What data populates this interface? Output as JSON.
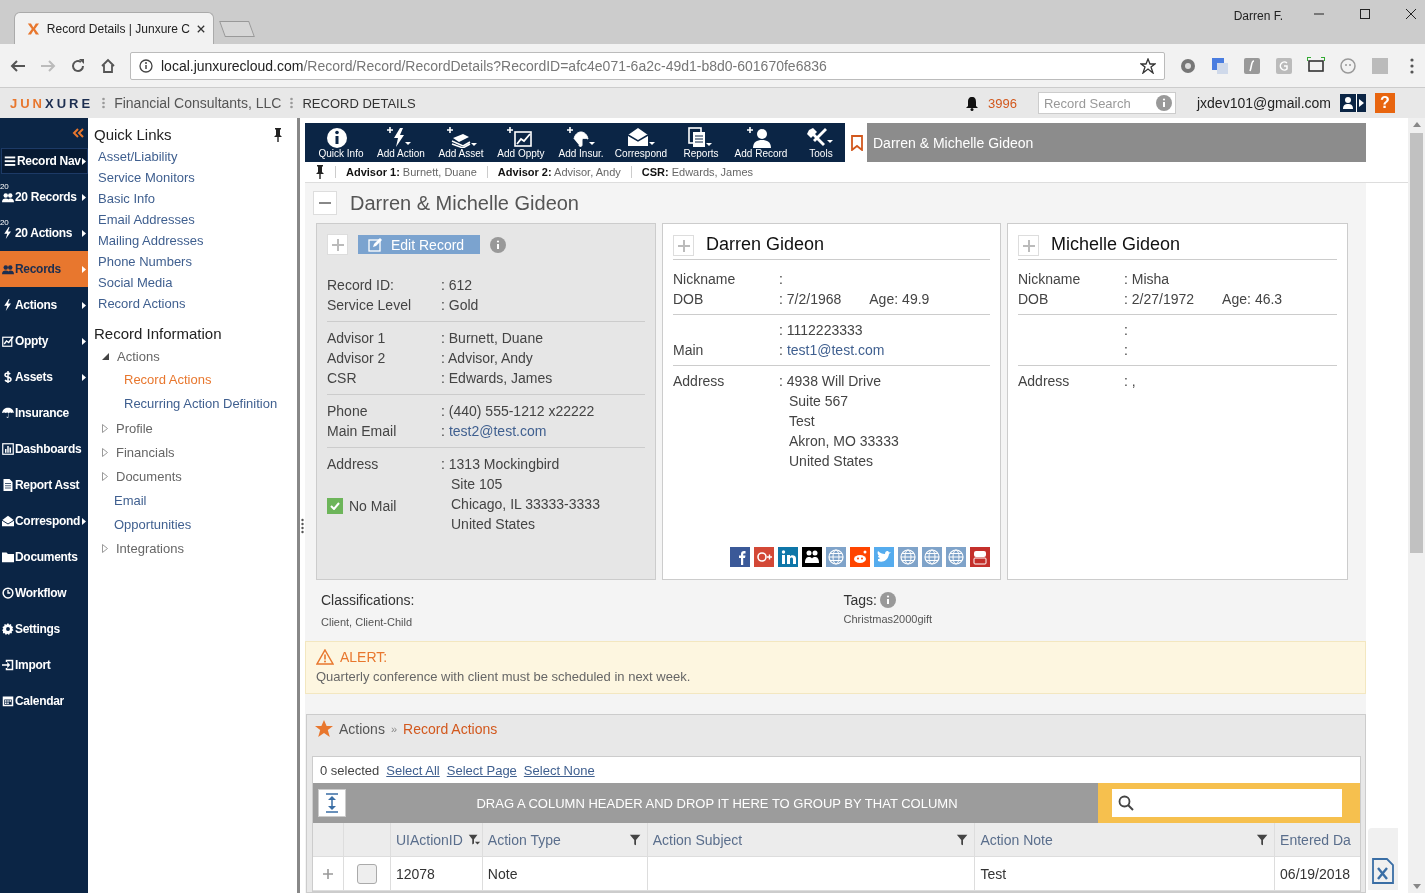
{
  "browser": {
    "tab_title": "Record Details | Junxure C",
    "url_host": "local.junxurecloud.com",
    "url_path": "/Record/Record/RecordDetails?RecordID=afc4e071-6a2c-49d1-b8d0-601670fe6836",
    "profile": "Darren F."
  },
  "app_header": {
    "logo": [
      "JUN",
      "XURE"
    ],
    "company": "Financial Consultants, LLC",
    "page": "RECORD DETAILS",
    "notification_count": "3996",
    "search": {
      "placeholder": "Record Search"
    },
    "email": "jxdev101@gmail.com",
    "help": "?"
  },
  "nav": [
    {
      "label": "Record Nav",
      "kind": "header",
      "submenu": true,
      "selected": false
    },
    {
      "label": "20 Records",
      "kind": "item",
      "badge": "20",
      "submenu": true,
      "selected": false
    },
    {
      "label": "20 Actions",
      "kind": "item",
      "badge": "20",
      "submenu": true,
      "selected": false
    },
    {
      "label": "Records",
      "kind": "item",
      "submenu": true,
      "selected": true
    },
    {
      "label": "Actions",
      "kind": "item",
      "submenu": true,
      "selected": false
    },
    {
      "label": "Oppty",
      "kind": "item",
      "submenu": true,
      "selected": false
    },
    {
      "label": "Assets",
      "kind": "item",
      "submenu": true,
      "selected": false
    },
    {
      "label": "Insurance",
      "kind": "item",
      "submenu": false,
      "selected": false
    },
    {
      "label": "Dashboards",
      "kind": "item",
      "submenu": false,
      "selected": false
    },
    {
      "label": "Report Asst",
      "kind": "item",
      "submenu": false,
      "selected": false
    },
    {
      "label": "Correspond",
      "kind": "item",
      "submenu": true,
      "selected": false
    },
    {
      "label": "Documents",
      "kind": "item",
      "submenu": false,
      "selected": false
    },
    {
      "label": "Workflow",
      "kind": "item",
      "submenu": false,
      "selected": false
    },
    {
      "label": "Settings",
      "kind": "item",
      "submenu": false,
      "selected": false
    },
    {
      "label": "Import",
      "kind": "item",
      "submenu": false,
      "selected": false
    },
    {
      "label": "Calendar",
      "kind": "item",
      "submenu": false,
      "selected": false
    }
  ],
  "quick_links": {
    "title": "Quick Links",
    "links": [
      "Asset/Liability",
      "Service Monitors",
      "Basic Info",
      "Email Addresses",
      "Mailing Addresses",
      "Phone Numbers",
      "Social Media",
      "Record Actions"
    ]
  },
  "record_information": {
    "title": "Record Information",
    "tree": [
      {
        "label": "Actions",
        "kind": "group",
        "expanded": true,
        "children": [
          {
            "label": "Record Actions",
            "selected": true
          },
          {
            "label": "Recurring Action Definition",
            "selected": false
          }
        ]
      },
      {
        "label": "Profile",
        "kind": "group",
        "expanded": false
      },
      {
        "label": "Financials",
        "kind": "group",
        "expanded": false
      },
      {
        "label": "Documents",
        "kind": "group",
        "expanded": false
      },
      {
        "label": "Email",
        "kind": "leaf"
      },
      {
        "label": "Opportunities",
        "kind": "leaf"
      },
      {
        "label": "Integrations",
        "kind": "group",
        "expanded": false
      }
    ]
  },
  "toolbar": {
    "buttons": [
      "Quick Info",
      "Add Action",
      "Add Asset",
      "Add Oppty",
      "Add Insur.",
      "Correspond",
      "Reports",
      "Add Record",
      "Tools"
    ],
    "record_title": "Darren & Michelle Gideon"
  },
  "advisor_bar": [
    {
      "label": "Advisor 1:",
      "value": "Burnett, Duane"
    },
    {
      "label": "Advisor 2:",
      "value": "Advisor, Andy"
    },
    {
      "label": "CSR:",
      "value": "Edwards, James"
    }
  ],
  "record": {
    "title": "Darren & Michelle Gideon",
    "main_card": {
      "edit_button": "Edit Record",
      "sections": [
        [
          {
            "label": "Record ID:",
            "value": ": 612"
          },
          {
            "label": "Service Level",
            "value": ": Gold"
          }
        ],
        [
          {
            "label": "Advisor 1",
            "value": ": Burnett, Duane"
          },
          {
            "label": "Advisor 2",
            "value": ": Advisor, Andy"
          },
          {
            "label": "CSR",
            "value": ": Edwards, James"
          }
        ],
        [
          {
            "label": "Phone",
            "value": ": (440) 555-1212 x22222"
          },
          {
            "label": "Main Email",
            "value": ":",
            "link": "test2@test.com"
          }
        ],
        [
          {
            "label": "Address",
            "value": ": 1313 Mockingbird",
            "lines": [
              "Site 105",
              "Chicago, IL 33333-3333",
              "United States"
            ]
          }
        ]
      ],
      "no_mail": {
        "label": "No Mail",
        "checked": true
      }
    },
    "people": [
      {
        "name": "Darren Gideon",
        "sections": [
          [
            {
              "label": "Nickname",
              "value": ":"
            },
            {
              "label": "DOB",
              "value": ": 7/2/1968",
              "age_label": "Age:",
              "age": "49.9"
            }
          ],
          [
            {
              "value": ": 1112223333"
            },
            {
              "label": "Main",
              "value": ":",
              "link": "test1@test.com"
            }
          ],
          [
            {
              "label": "Address",
              "value": ": 4938 Will Drive",
              "lines": [
                "Suite 567",
                "Test",
                "Akron, MO 33333",
                "United States"
              ]
            }
          ]
        ],
        "social": true
      },
      {
        "name": "Michelle Gideon",
        "sections": [
          [
            {
              "label": "Nickname",
              "value": ": Misha"
            },
            {
              "label": "DOB",
              "value": ": 2/27/1972",
              "age_label": "Age:",
              "age": "46.3"
            }
          ],
          [
            {
              "value": ":"
            },
            {
              "value": ":"
            }
          ],
          [
            {
              "label": "Address",
              "value": ": ,"
            }
          ]
        ],
        "social": false
      }
    ],
    "classifications": {
      "label": "Classifications:",
      "value": "Client, Client-Child"
    },
    "tags": {
      "label": "Tags:",
      "value": "Christmas2000gift"
    },
    "alert": {
      "title": "ALERT:",
      "message": "Quarterly conference with client must be scheduled in next week."
    }
  },
  "actions_panel": {
    "breadcrumb": [
      "Actions",
      "»",
      "Record Actions"
    ],
    "selected_count": "0 selected",
    "select_links": [
      "Select All",
      "Select Page",
      "Select None"
    ],
    "group_banner": "DRAG A COLUMN HEADER AND DROP IT HERE TO GROUP BY THAT COLUMN",
    "columns": [
      {
        "label": "UIActionID",
        "kind": "sort"
      },
      {
        "label": "Action Type",
        "kind": "filter"
      },
      {
        "label": "Action Subject",
        "kind": "filter"
      },
      {
        "label": "Action Note",
        "kind": "filter"
      },
      {
        "label": "Entered Da",
        "kind": "plain"
      }
    ],
    "rows": [
      {
        "checked": false,
        "cells": [
          "12078",
          "Note",
          "",
          "Test",
          "06/19/2018"
        ]
      }
    ]
  }
}
